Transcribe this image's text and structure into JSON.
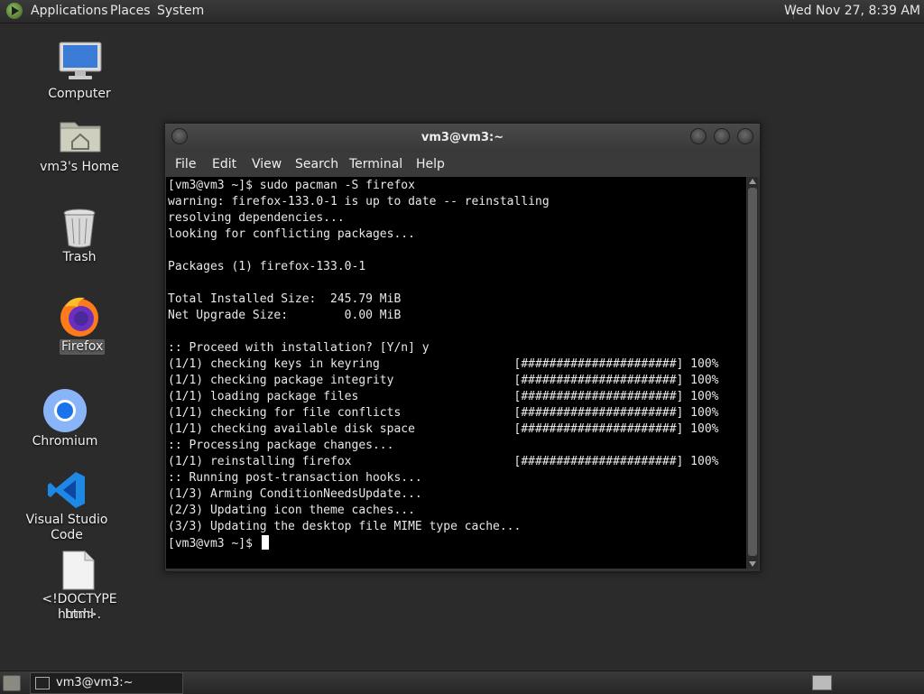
{
  "top_panel": {
    "menus": [
      "Applications",
      "Places",
      "System"
    ],
    "clock": "Wed Nov 27,  8:39 AM"
  },
  "desktop": {
    "icons": [
      {
        "label": "Computer",
        "icon": "computer-icon"
      },
      {
        "label": "vm3's Home",
        "icon": "home-folder-icon"
      },
      {
        "label": "Trash",
        "icon": "trash-icon"
      },
      {
        "label": "Firefox",
        "icon": "firefox-icon"
      },
      {
        "label": "Chromium",
        "icon": "chromium-icon"
      },
      {
        "label": "Visual Studio Code",
        "icon": "vscode-icon"
      },
      {
        "label_line1": "<!DOCTYPE html>.",
        "label_line2": "html",
        "icon": "text-file-icon"
      }
    ]
  },
  "terminal": {
    "title": "vm3@vm3:~",
    "menu": [
      "File",
      "Edit",
      "View",
      "Search",
      "Terminal",
      "Help"
    ],
    "lines": [
      "[vm3@vm3 ~]$ sudo pacman -S firefox",
      "warning: firefox-133.0-1 is up to date -- reinstalling",
      "resolving dependencies...",
      "looking for conflicting packages...",
      "",
      "Packages (1) firefox-133.0-1",
      "",
      "Total Installed Size:  245.79 MiB",
      "Net Upgrade Size:        0.00 MiB",
      "",
      ":: Proceed with installation? [Y/n] y",
      "(1/1) checking keys in keyring                   [######################] 100%",
      "(1/1) checking package integrity                 [######################] 100%",
      "(1/1) loading package files                      [######################] 100%",
      "(1/1) checking for file conflicts                [######################] 100%",
      "(1/1) checking available disk space              [######################] 100%",
      ":: Processing package changes...",
      "(1/1) reinstalling firefox                       [######################] 100%",
      ":: Running post-transaction hooks...",
      "(1/3) Arming ConditionNeedsUpdate...",
      "(2/3) Updating icon theme caches...",
      "(3/3) Updating the desktop file MIME type cache...",
      "[vm3@vm3 ~]$ "
    ]
  },
  "taskbar": {
    "task_label": "vm3@vm3:~"
  }
}
